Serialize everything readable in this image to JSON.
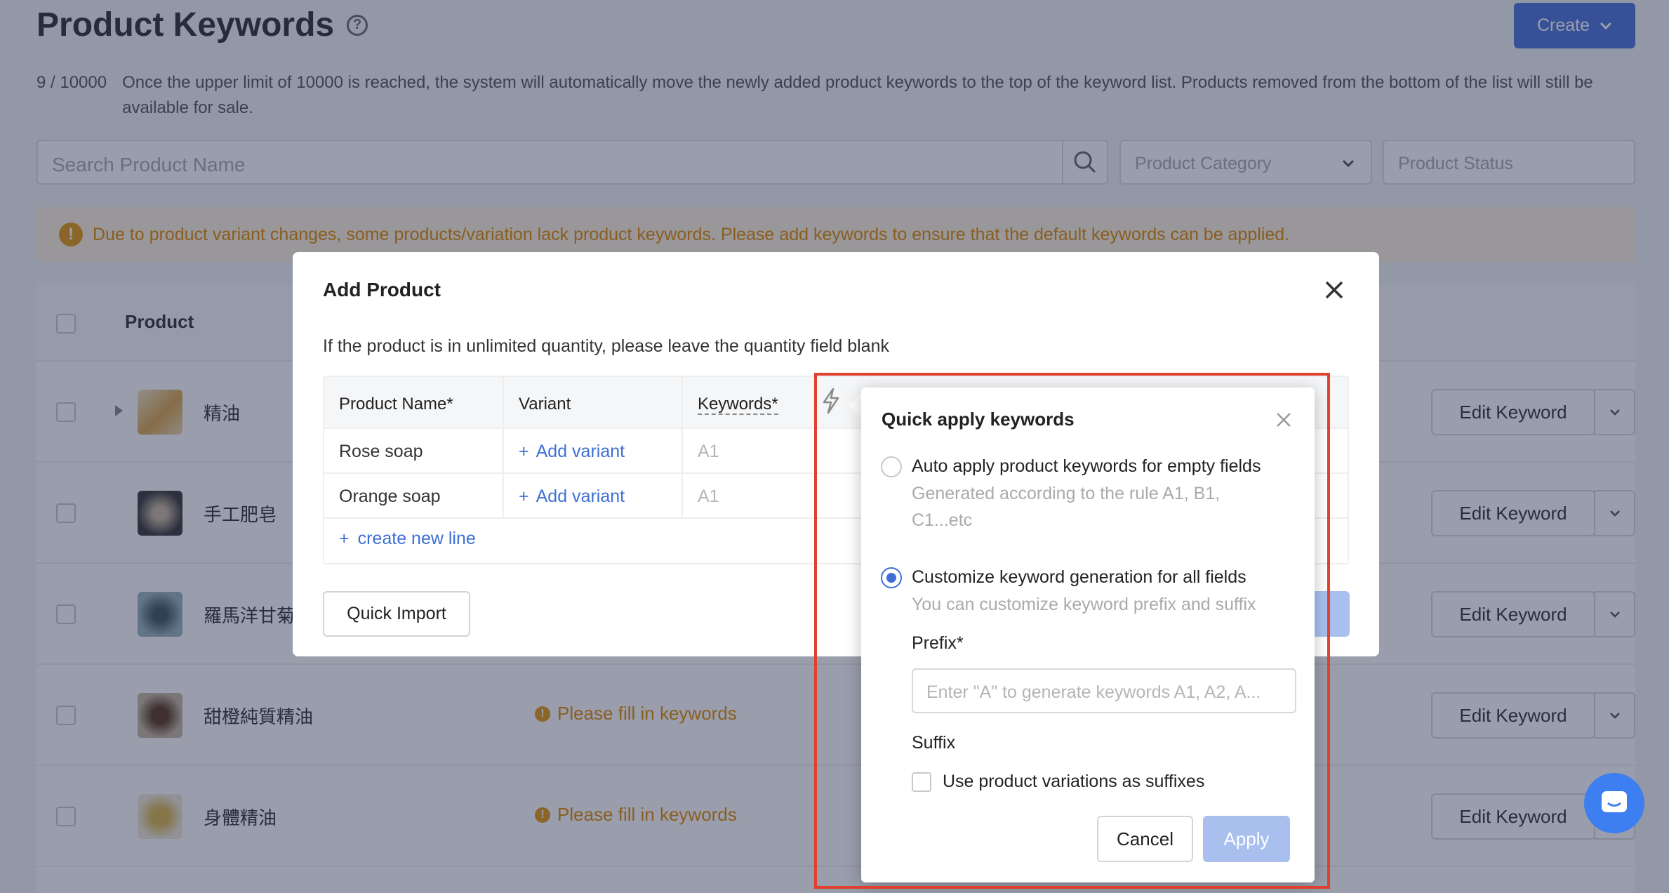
{
  "page": {
    "title": "Product Keywords",
    "create_label": "Create",
    "limit_count": "9 / 10000",
    "limit_text": "Once the upper limit of 10000 is reached, the system will automatically move the newly added product keywords to the top of the keyword list. Products removed from the bottom of the list will still be available for sale.",
    "search_placeholder": "Search Product Name",
    "category_placeholder": "Product Category",
    "status_placeholder": "Product Status",
    "warning": "Due to product variant changes, some products/variation lack product keywords. Please add keywords to ensure that the default keywords can be applied.",
    "table_header_product": "Product",
    "rows": [
      {
        "name": "精油",
        "keyword_status": "",
        "action": "Edit Keyword"
      },
      {
        "name": "手工肥皂",
        "keyword_status": "",
        "action": "Edit Keyword"
      },
      {
        "name": "羅馬洋甘菊",
        "keyword_status": "",
        "action": "Edit Keyword"
      },
      {
        "name": "甜橙純質精油",
        "keyword_status": "Please fill in keywords",
        "action": "Edit Keyword"
      },
      {
        "name": "身體精油",
        "keyword_status": "Please fill in keywords",
        "action": "Edit Keyword"
      }
    ]
  },
  "modal": {
    "title": "Add Product",
    "note": "If the product is in unlimited quantity, please leave the quantity field blank",
    "columns": [
      "Product Name*",
      "Variant",
      "Keywords*"
    ],
    "lines": [
      {
        "name": "Rose soap",
        "variant": "Add variant",
        "keyword": "A1"
      },
      {
        "name": "Orange soap",
        "variant": "Add variant",
        "keyword": "A1"
      }
    ],
    "create_line": "create new line",
    "quick_import": "Quick Import"
  },
  "popover": {
    "title": "Quick apply keywords",
    "option1_label": "Auto apply product keywords for empty fields",
    "option1_desc": "Generated according to the rule A1, B1, C1...etc",
    "option2_label": "Customize keyword generation for all fields",
    "option2_desc": "You can customize keyword prefix and suffix",
    "selected_option": 2,
    "prefix_label": "Prefix*",
    "prefix_placeholder": "Enter \"A\" to generate keywords A1, A2, A...",
    "suffix_label": "Suffix",
    "suffix_checkbox": "Use product variations as suffixes",
    "cancel": "Cancel",
    "apply": "Apply"
  },
  "colors": {
    "accent": "#3f6fd6",
    "warning": "#e08a00",
    "highlight": "#e0412d"
  }
}
